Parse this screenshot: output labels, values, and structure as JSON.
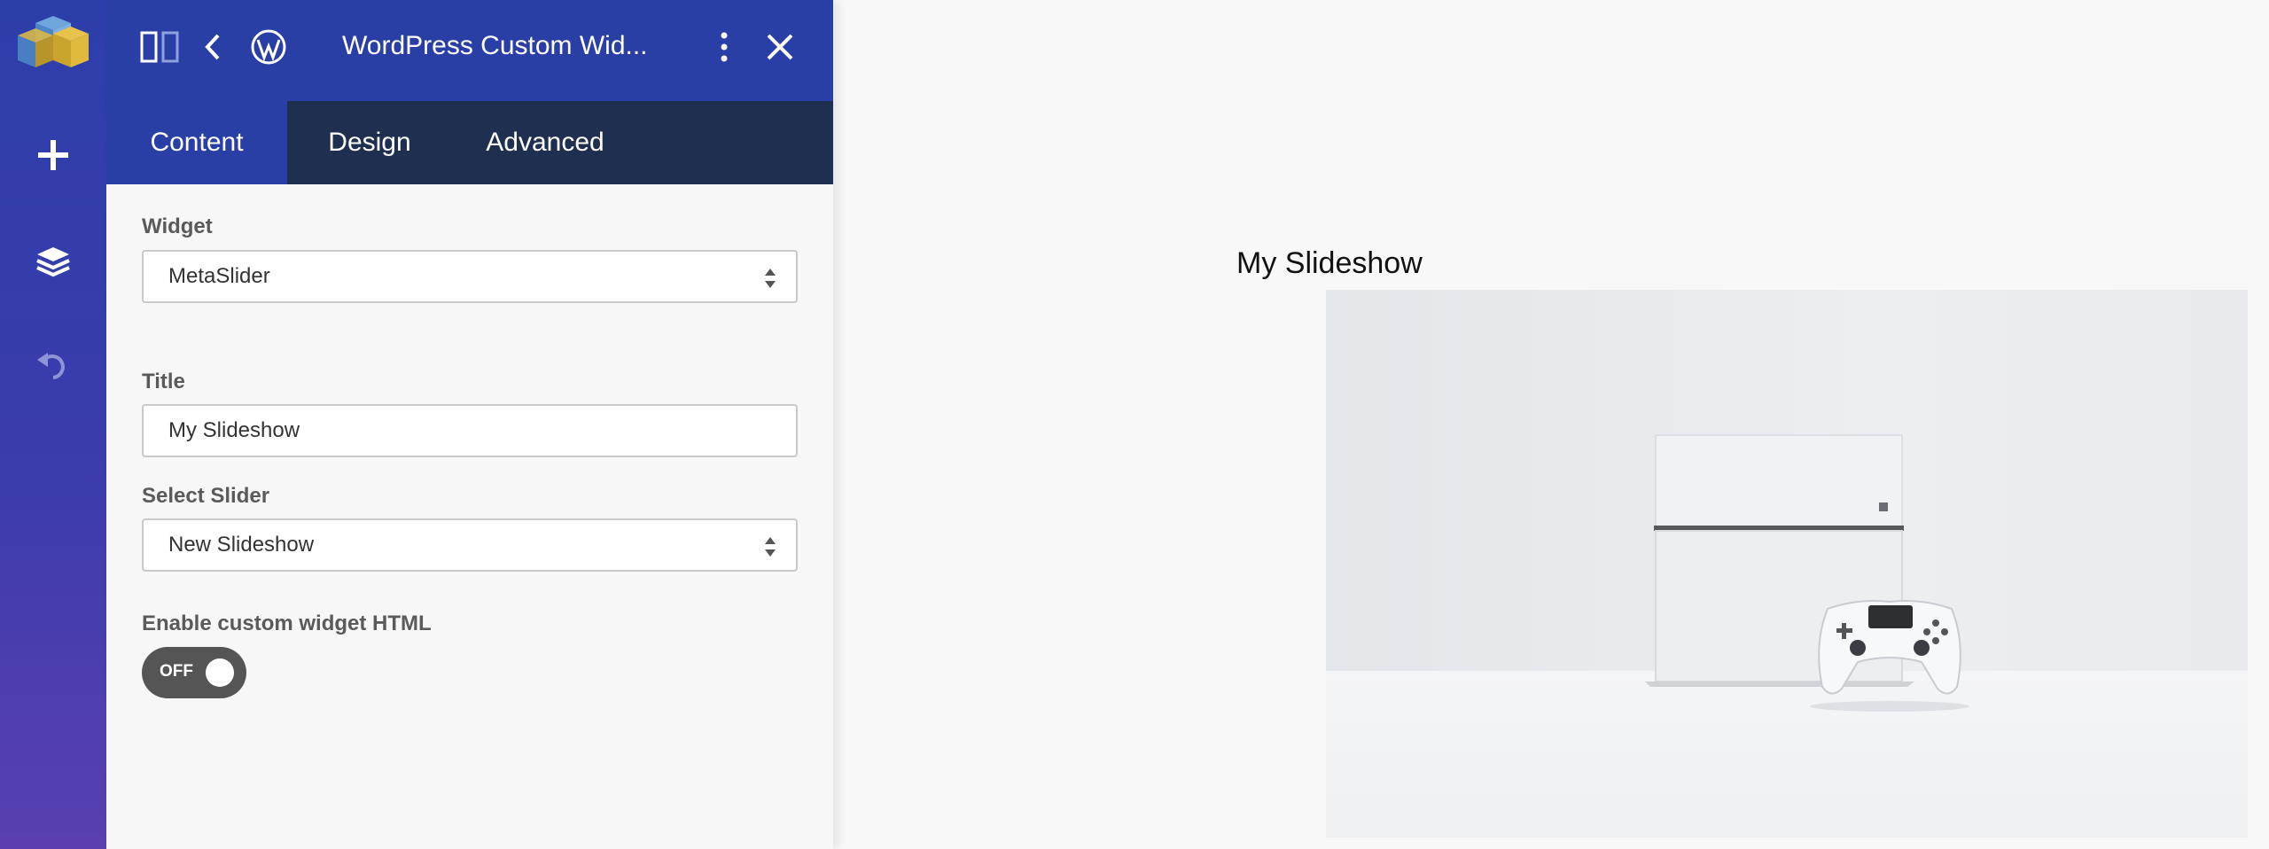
{
  "header": {
    "title": "WordPress Custom Wid..."
  },
  "tabs": [
    {
      "label": "Content",
      "active": true
    },
    {
      "label": "Design",
      "active": false
    },
    {
      "label": "Advanced",
      "active": false
    }
  ],
  "form": {
    "widget": {
      "label": "Widget",
      "value": "MetaSlider"
    },
    "title": {
      "label": "Title",
      "value": "My Slideshow"
    },
    "slider": {
      "label": "Select Slider",
      "value": "New Slideshow"
    },
    "custom_html": {
      "label": "Enable custom widget HTML",
      "toggle_text": "OFF",
      "enabled": false
    }
  },
  "preview": {
    "title": "My Slideshow"
  },
  "icons": [
    "app-logo-icon",
    "plus-icon",
    "layers-icon",
    "undo-icon",
    "panel-toggle-icon",
    "back-chevron-icon",
    "wordpress-icon",
    "more-vertical-icon",
    "close-icon",
    "select-arrows-icon"
  ],
  "colors": {
    "rail_top": "#2c3eaa",
    "rail_bottom": "#5a3fb0",
    "header": "#2a3fa6",
    "tabs_bg": "#1f2f4f",
    "toggle_off": "#555555"
  }
}
